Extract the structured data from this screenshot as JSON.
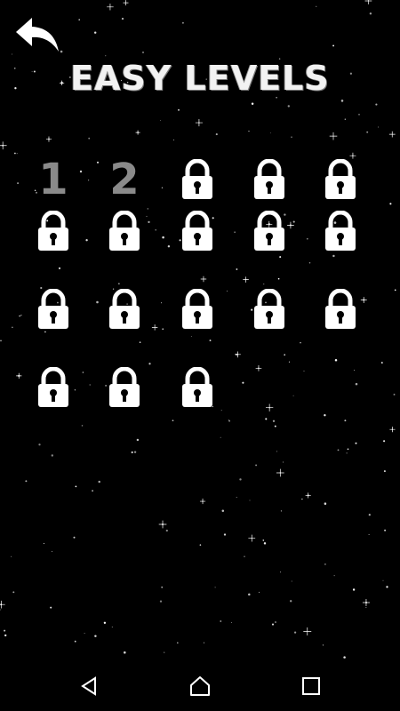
{
  "title": "EASY LEVELS",
  "levels": [
    {
      "state": "unlocked",
      "label": "1"
    },
    {
      "state": "unlocked",
      "label": "2"
    },
    {
      "state": "locked",
      "icon": "lock-icon"
    },
    {
      "state": "locked",
      "icon": "lock-icon"
    },
    {
      "state": "locked",
      "icon": "lock-icon"
    },
    {
      "state": "locked",
      "icon": "lock-icon"
    },
    {
      "state": "locked",
      "icon": "lock-icon"
    },
    {
      "state": "locked",
      "icon": "lock-icon"
    },
    {
      "state": "locked",
      "icon": "lock-icon"
    },
    {
      "state": "locked",
      "icon": "lock-icon"
    },
    {
      "state": "locked",
      "icon": "lock-icon"
    },
    {
      "state": "locked",
      "icon": "lock-icon"
    },
    {
      "state": "locked",
      "icon": "lock-icon"
    },
    {
      "state": "locked",
      "icon": "lock-icon"
    },
    {
      "state": "locked",
      "icon": "lock-icon"
    },
    {
      "state": "locked",
      "icon": "lock-icon"
    },
    {
      "state": "locked",
      "icon": "lock-icon"
    },
    {
      "state": "locked",
      "icon": "lock-icon"
    }
  ],
  "icons": {
    "back": "back-arrow-icon",
    "nav_back": "nav-back-icon",
    "nav_home": "nav-home-icon",
    "nav_recents": "nav-recents-icon"
  },
  "colors": {
    "background": "#000000",
    "locked": "#ffffff",
    "unlocked_number": "#8a8a8a",
    "title": "#f2f2f2"
  }
}
